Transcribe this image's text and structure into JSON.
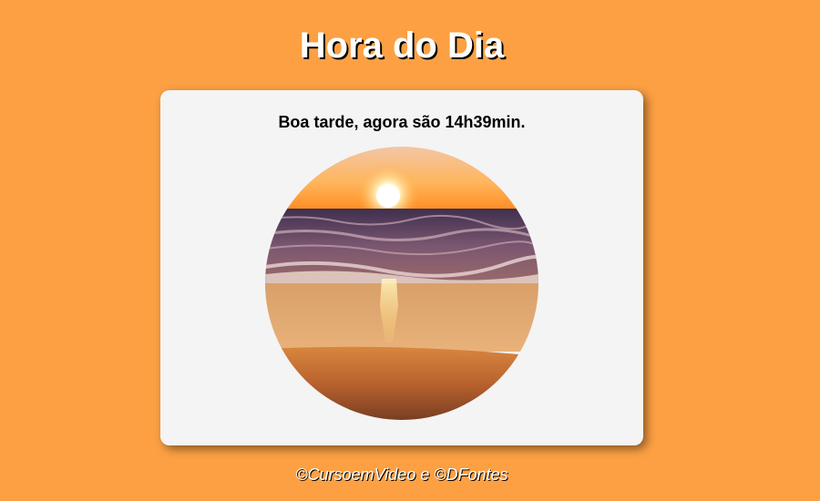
{
  "header": {
    "title": "Hora do Dia"
  },
  "card": {
    "message": "Boa tarde, agora são 14h39min.",
    "image": {
      "icon": "sunset-beach-photo",
      "colors": {
        "sky_top": "#f4c89a",
        "sky_horizon": "#ff9a2e",
        "sun": "#fffbe6",
        "sea": "#6a4a66",
        "sand": "#c9703a"
      }
    }
  },
  "footer": {
    "credits": "©CursoemVideo e ©DFontes"
  },
  "theme": {
    "background": "#fca043",
    "card_background": "#f4f4f4"
  }
}
